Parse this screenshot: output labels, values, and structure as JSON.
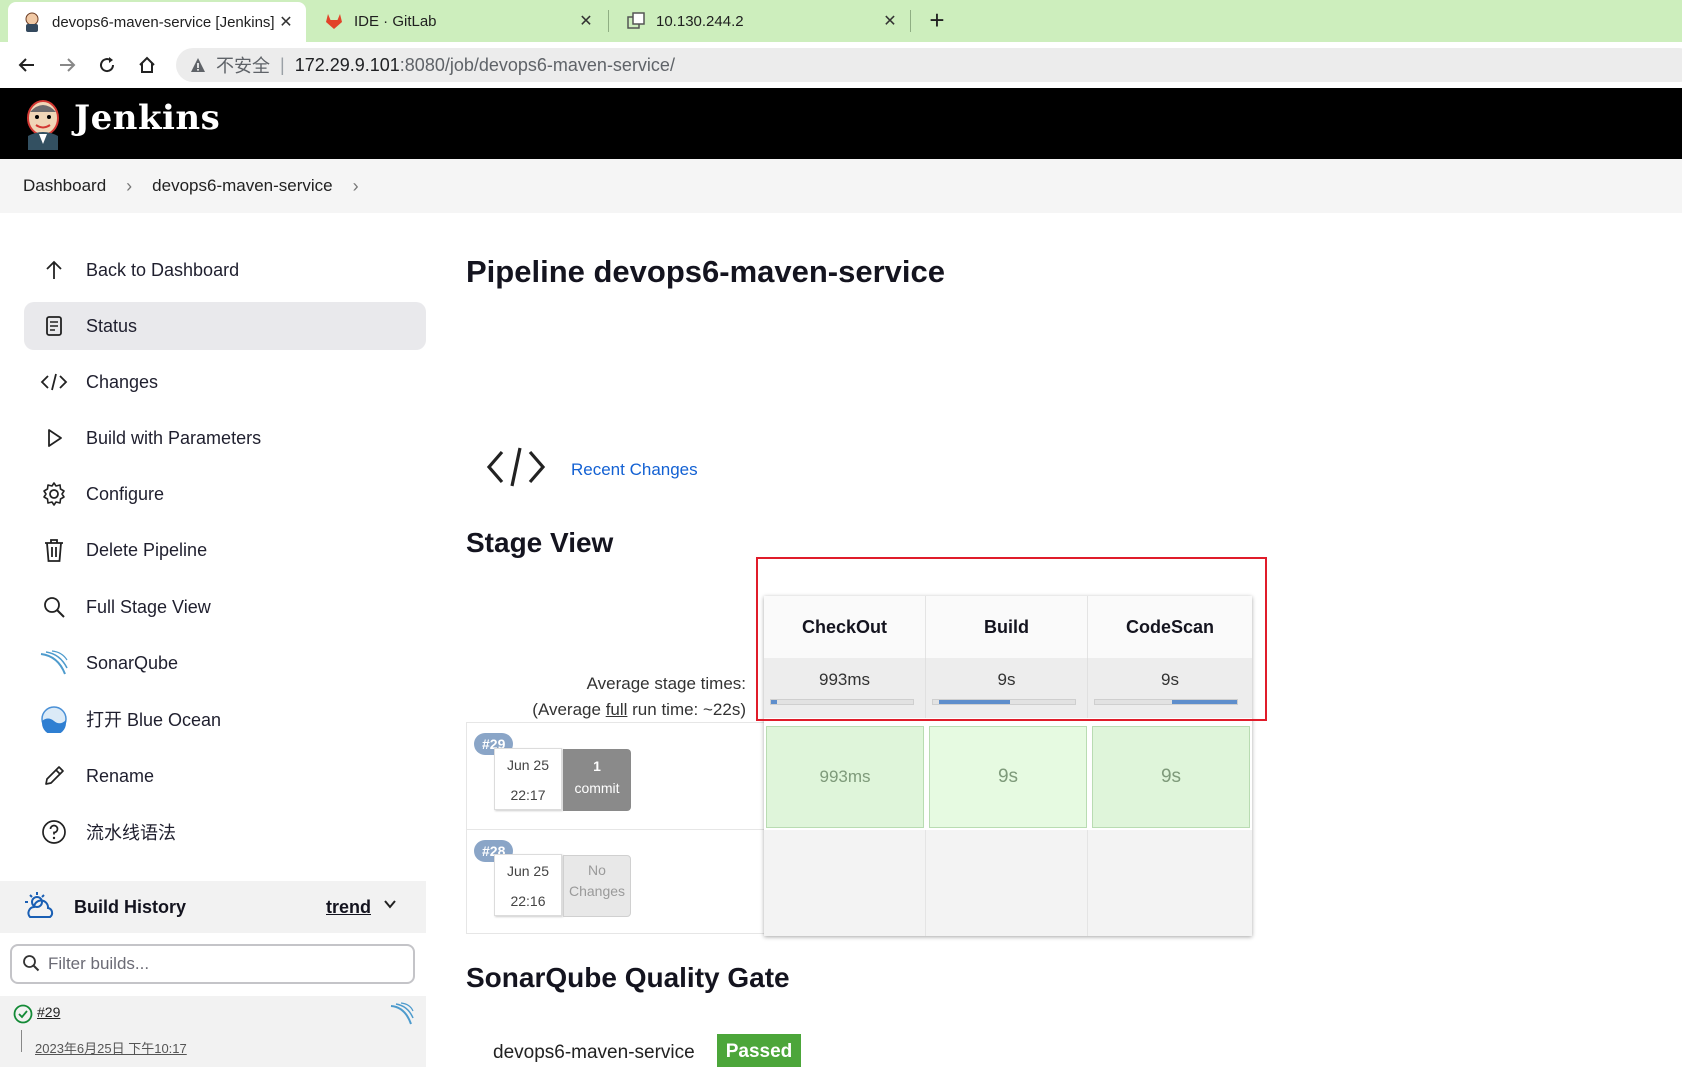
{
  "browser": {
    "tabs": [
      {
        "title": "devops6-maven-service [Jenkins]",
        "icon": "jenkins-icon",
        "active": true
      },
      {
        "title": "IDE · GitLab",
        "icon": "gitlab-icon",
        "active": false
      },
      {
        "title": "10.130.244.2",
        "icon": "remote-desktop-icon",
        "active": false
      }
    ],
    "close_glyph": "✕",
    "new_tab_glyph": "+",
    "address": {
      "insecure_label": "不安全",
      "separator": "|",
      "host": "172.29.9.101",
      "path": ":8080/job/devops6-maven-service/"
    }
  },
  "header": {
    "title": "Jenkins"
  },
  "breadcrumbs": {
    "items": [
      "Dashboard",
      "devops6-maven-service"
    ],
    "chevron": "›"
  },
  "sidebar": {
    "items": [
      {
        "label": "Back to Dashboard",
        "icon": "arrow-up-icon"
      },
      {
        "label": "Status",
        "icon": "document-icon"
      },
      {
        "label": "Changes",
        "icon": "code-icon"
      },
      {
        "label": "Build with Parameters",
        "icon": "play-icon"
      },
      {
        "label": "Configure",
        "icon": "gear-icon"
      },
      {
        "label": "Delete Pipeline",
        "icon": "trash-icon"
      },
      {
        "label": "Full Stage View",
        "icon": "search-icon"
      },
      {
        "label": "SonarQube",
        "icon": "sonarqube-icon"
      },
      {
        "label": "打开 Blue Ocean",
        "icon": "blue-ocean-icon"
      },
      {
        "label": "Rename",
        "icon": "pencil-icon"
      },
      {
        "label": "流水线语法",
        "icon": "help-icon"
      }
    ],
    "build_history": {
      "label": "Build History",
      "trend": "trend",
      "filter_placeholder": "Filter builds...",
      "builds": [
        {
          "number": "#29",
          "date": "2023年6月25日 下午10:17",
          "status": "success"
        }
      ]
    }
  },
  "main": {
    "title": "Pipeline devops6-maven-service",
    "recent_changes": "Recent Changes",
    "stage_view": {
      "title": "Stage View",
      "avg_label_line1": "Average stage times:",
      "avg_label_pre": "(Average ",
      "avg_label_full": "full",
      "avg_label_post": " run time: ~22s)",
      "stages": [
        {
          "name": "CheckOut",
          "avg": "993ms",
          "fill_start": 0.0,
          "fill_end": 0.04
        },
        {
          "name": "Build",
          "avg": "9s",
          "fill_start": 0.04,
          "fill_end": 0.54
        },
        {
          "name": "CodeScan",
          "avg": "9s",
          "fill_start": 0.54,
          "fill_end": 1.0
        }
      ],
      "runs": [
        {
          "badge": "#29",
          "date": "Jun 25",
          "time": "22:17",
          "commits_n": "1",
          "commits_w": "commit",
          "durations": [
            "993ms",
            "9s",
            "9s"
          ]
        },
        {
          "badge": "#28",
          "date": "Jun 25",
          "time": "22:16",
          "commits_n": "No",
          "commits_w": "Changes",
          "durations": []
        }
      ]
    },
    "sonarqube": {
      "title": "SonarQube Quality Gate",
      "project": "devops6-maven-service",
      "status": "Passed"
    }
  },
  "colors": {
    "tabbar": "#cdeebd",
    "success_cell": "#dff5da",
    "avg_bar": "#5e8ecc",
    "highlight": "#e01c2a",
    "passed": "#4ca63a",
    "link": "#1361d3"
  }
}
